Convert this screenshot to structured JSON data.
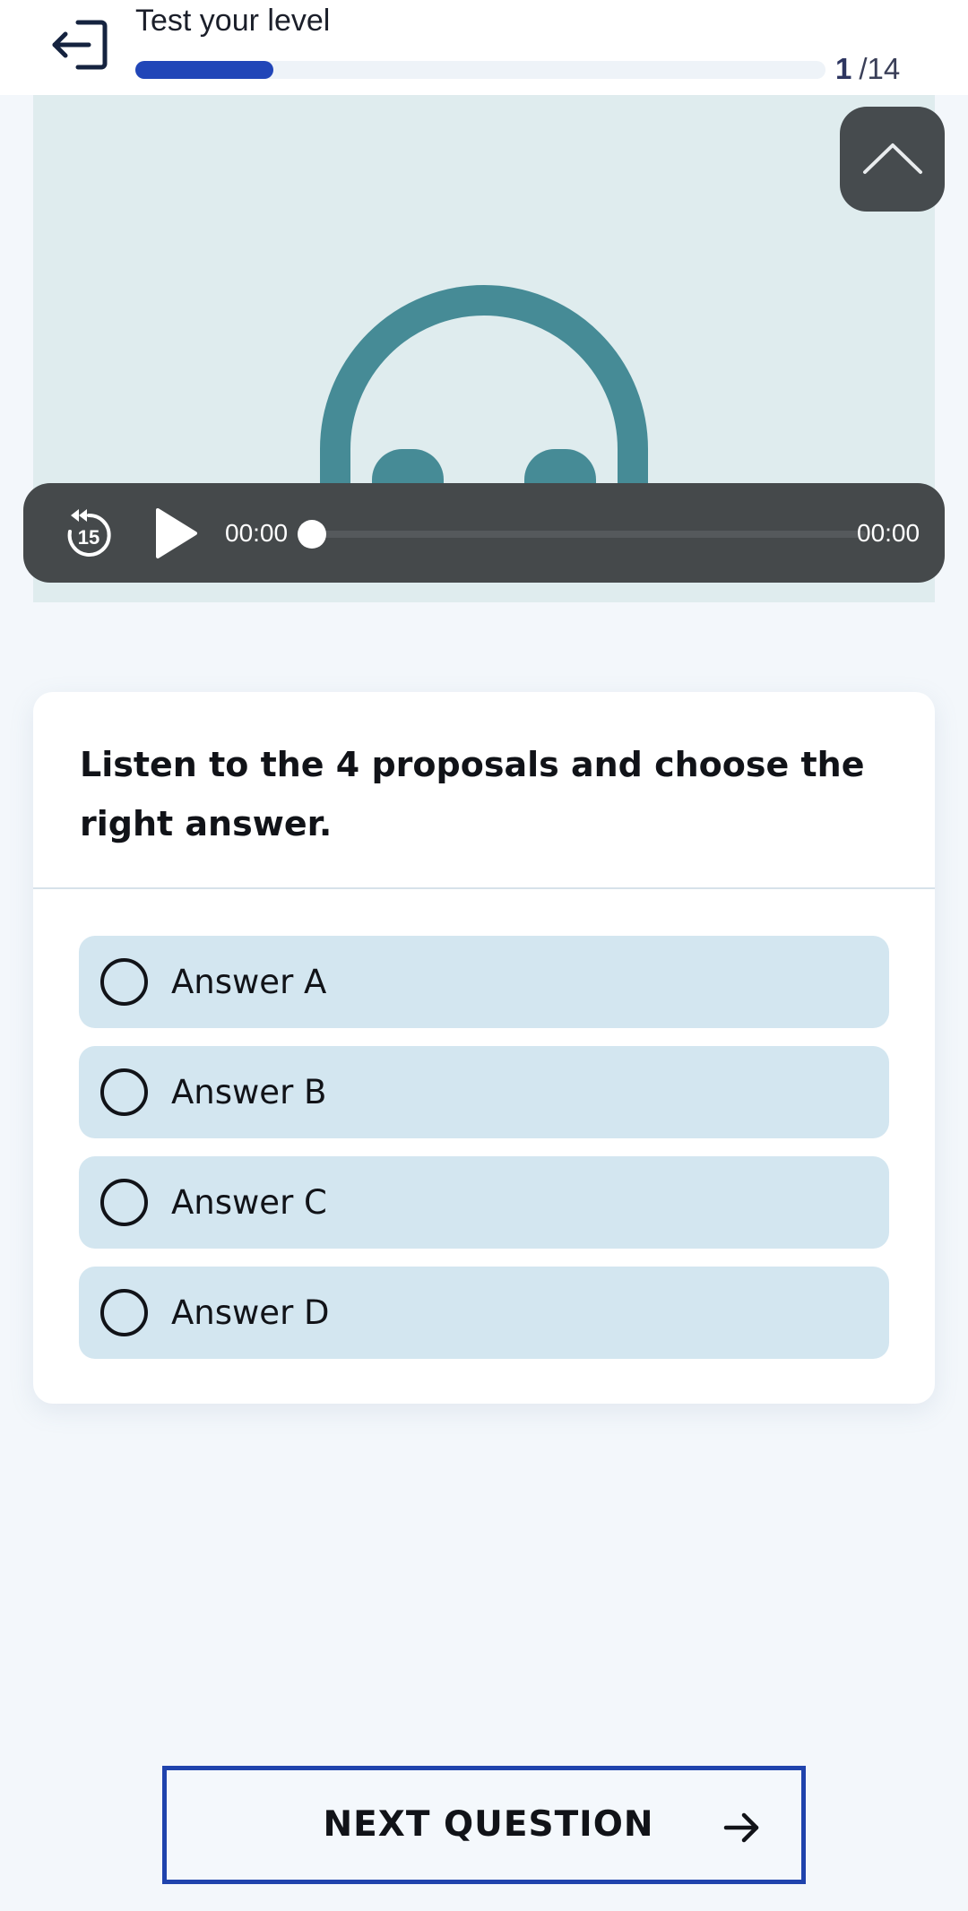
{
  "header": {
    "title": "Test your level",
    "progress": {
      "current": "1",
      "total": "/14",
      "fraction": 0.2
    },
    "exit_icon": "exit-icon"
  },
  "media": {
    "illustration": "headphones-icon",
    "collapse_icon": "chevron-up-icon",
    "player": {
      "rewind_icon": "rewind-15-icon",
      "rewind_text": "15",
      "play_icon": "play-icon",
      "current_time": "00:00",
      "total_time": "00:00",
      "seek_fraction": 0
    }
  },
  "question": {
    "prompt": "Listen to the 4 proposals and choose the right answer.",
    "options": [
      {
        "label": "Answer A"
      },
      {
        "label": "Answer B"
      },
      {
        "label": "Answer C"
      },
      {
        "label": "Answer D"
      }
    ]
  },
  "footer": {
    "next_label": "NEXT QUESTION",
    "next_icon": "arrow-right-icon"
  },
  "colors": {
    "accent": "#2146b8",
    "media_bg": "#dfecee",
    "headphones": "#468b96",
    "player_bg": "#45494b",
    "option_bg": "#d3e6f0",
    "page_bg": "#f3f7fb"
  }
}
